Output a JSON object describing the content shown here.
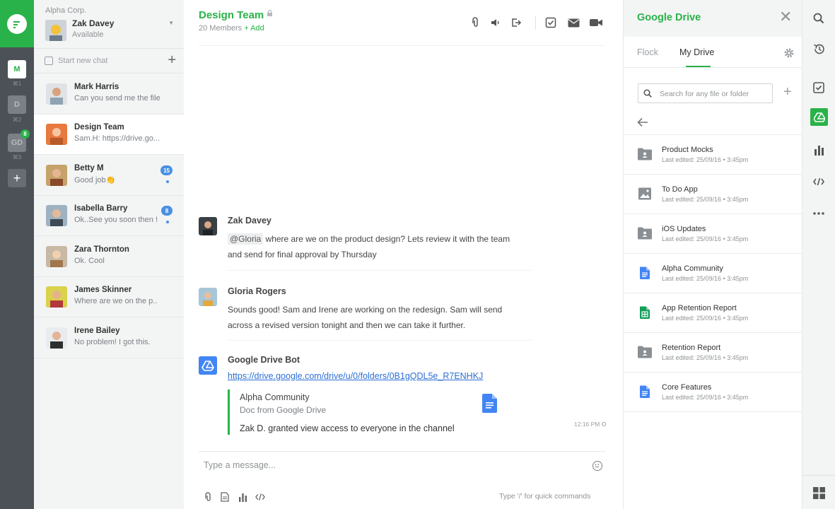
{
  "rail": {
    "workspaces": [
      {
        "letter": "M",
        "shortcut": "⌘1"
      },
      {
        "letter": "D",
        "shortcut": "⌘2"
      },
      {
        "letter": "GD",
        "shortcut": "⌘3",
        "badge": "8"
      }
    ],
    "add_label": "+"
  },
  "me": {
    "org": "Alpha Corp.",
    "name": "Zak Davey",
    "status": "Available"
  },
  "new_chat": {
    "label": "Start new chat"
  },
  "chats": [
    {
      "name": "Mark Harris",
      "preview": "Can you send me the file"
    },
    {
      "name": "Design Team",
      "preview": "Sam.H: https://drive.go..."
    },
    {
      "name": "Betty M",
      "preview": "Good job👏",
      "badge": "15"
    },
    {
      "name": "Isabella Barry",
      "preview": "Ok..See you soon then !",
      "badge": "8"
    },
    {
      "name": "Zara Thornton",
      "preview": "Ok. Cool"
    },
    {
      "name": "James Skinner",
      "preview": "Where are we on the p.."
    },
    {
      "name": "Irene Bailey",
      "preview": "No problem! I got this."
    }
  ],
  "channel": {
    "title": "Design Team",
    "members": "20 Members",
    "add": "+ Add"
  },
  "messages": [
    {
      "author": "Zak Davey",
      "mention": "@Gloria",
      "text": " where are we on the product design? Lets review it with the team and send for final approval by Thursday"
    },
    {
      "author": "Gloria Rogers",
      "text": "Sounds good! Sam and Irene are working on the redesign. Sam will send across a revised version tonight and then we can take it further."
    },
    {
      "author": "Google Drive Bot",
      "link": "https://drive.google.com/drive/u/0/folders/0B1gQDL5e_R7ENHKJ",
      "attachment": {
        "title": "Alpha Community",
        "subtitle": "Doc from Google Drive",
        "text": "Zak D. granted view access to everyone in the channel"
      },
      "time": "12:16 PM"
    }
  ],
  "composer": {
    "placeholder": "Type a message...",
    "hint": "Type '/' for quick commands"
  },
  "drive": {
    "title": "Google Drive",
    "tabs": [
      "Flock",
      "My Drive"
    ],
    "search_placeholder": "Search for any file or folder",
    "files": [
      {
        "name": "Product Mocks",
        "edited": "Last edited:  25/09/16  •  3:45pm",
        "icon": "shared-folder-icon"
      },
      {
        "name": "To Do App",
        "edited": "Last edited:  25/09/16  •  3:45pm",
        "icon": "image-icon"
      },
      {
        "name": "iOS Updates",
        "edited": "Last edited:  25/09/16  •  3:45pm",
        "icon": "shared-folder-icon"
      },
      {
        "name": "Alpha Community",
        "edited": "Last edited:  25/09/16  •  3:45pm",
        "icon": "google-doc-icon"
      },
      {
        "name": "App Retention Report",
        "edited": "Last edited:  25/09/16  •  3:45pm",
        "icon": "google-sheet-icon"
      },
      {
        "name": "Retention Report",
        "edited": "Last edited:  25/09/16  •  3:45pm",
        "icon": "shared-folder-icon"
      },
      {
        "name": "Core Features",
        "edited": "Last edited:  25/09/16  •  3:45pm",
        "icon": "google-doc-icon"
      }
    ]
  },
  "colors": {
    "brand_green": "#2ab24a",
    "rail_dark": "#4b5157",
    "badge_blue": "#4a90e2",
    "link_blue": "#2b6fd6",
    "doc_blue": "#4285f4",
    "sheet_green": "#0f9d58"
  }
}
